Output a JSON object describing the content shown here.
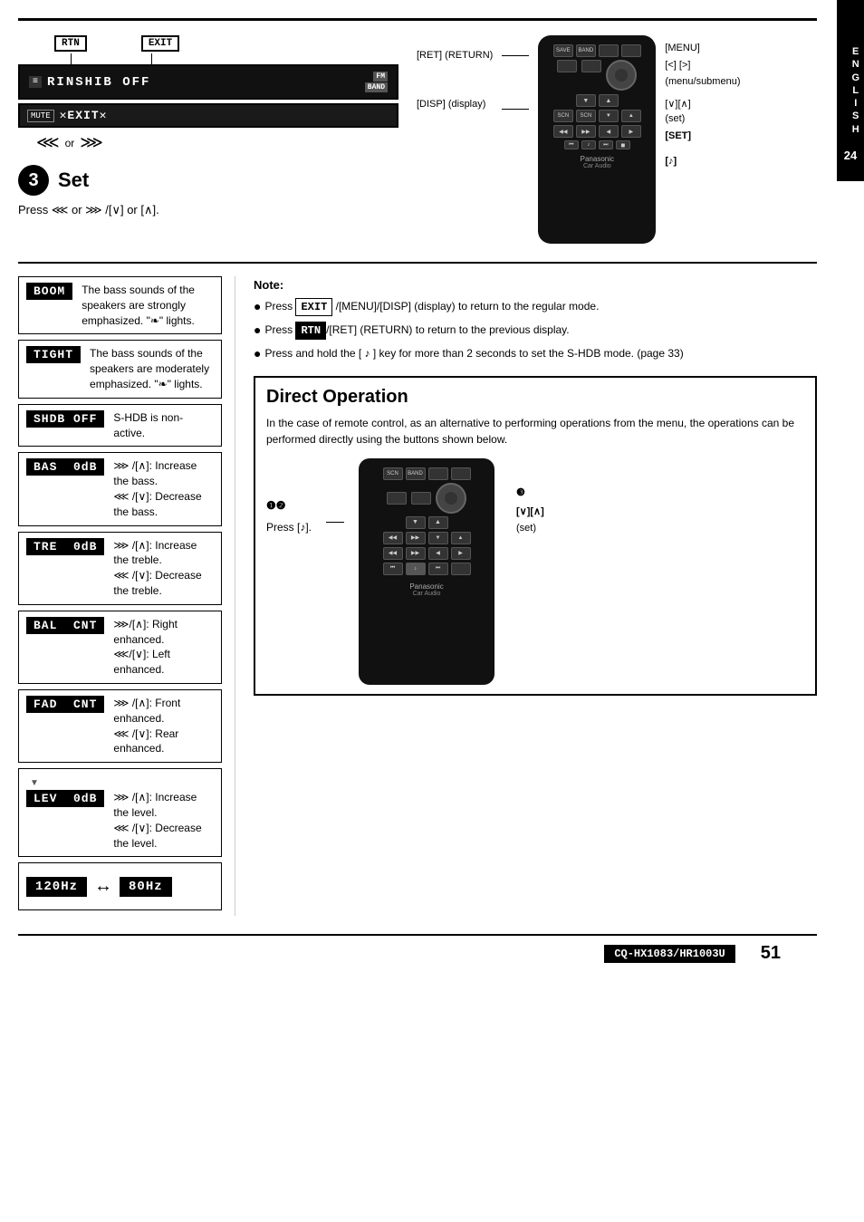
{
  "page": {
    "number": "51",
    "model": "CQ-HX1083/HR1003U",
    "lang_tab": [
      "E",
      "N",
      "G",
      "L",
      "I",
      "S",
      "H"
    ],
    "lang_num": "24"
  },
  "top_section": {
    "display_text": "RINSHIB OFF",
    "btn_rtn": "RTN",
    "btn_exit": "EXIT",
    "or_text": "or",
    "step3_circle": "3",
    "step3_title": "Set",
    "press_text": "Press",
    "press_instruction": "Press  ◀◀  or  ▶▶ /[∨] or [∧]."
  },
  "remote_labels": {
    "ret_return": "[RET] (RETURN)",
    "menu": "[MENU]",
    "ltgt": "[<] [>]",
    "menu_submenu": "(menu/submenu)",
    "vcaret": "[∨][∧]",
    "set": "(set)",
    "set_bracket": "[SET]",
    "disp": "[DISP] (display)",
    "music_note": "[♪]"
  },
  "settings": [
    {
      "label": "BOOM",
      "desc": "The bass sounds of the speakers are strongly emphasized. \"❧\" lights."
    },
    {
      "label": "TIGHT",
      "desc": "The bass sounds of the speakers are moderately emphasized. \"❧\" lights."
    },
    {
      "label": "SHDB OFF",
      "desc": "S-HDB is non-active."
    },
    {
      "label": "BAS  0dB",
      "up_desc": "▶▶ /[∧]: Increase the bass.",
      "down_desc": "◀◀ /[∨]: Decrease the bass."
    },
    {
      "label": "TRE  0dB",
      "up_desc": "▶▶ /[∧]: Increase the treble.",
      "down_desc": "◀◀ /[∨]: Decrease the treble."
    },
    {
      "label": "BAL  CNT",
      "up_desc": "▶▶/[∧]: Right enhanced.",
      "down_desc": "◀◀/[∨]: Left enhanced."
    },
    {
      "label": "FAD  CNT",
      "up_desc": "▶▶ /[∧]: Front enhanced.",
      "down_desc": "◀◀ /[∨]: Rear enhanced."
    },
    {
      "label": "LEV  0dB",
      "up_desc": "▶▶ /[∧]: Increase the level.",
      "down_desc": "◀◀ /[∨]: Decrease the level."
    }
  ],
  "freq_row": {
    "left": "120Hz",
    "arrow": "↔",
    "right": "80Hz"
  },
  "notes": {
    "title": "Note:",
    "items": [
      "Press  EXIT  /[MENU]/[DISP] (display) to return to the regular mode.",
      "Press  RTN /[RET] (RETURN) to return to the previous display.",
      "Press and hold the [ ♪ ] key for more than 2 seconds to set the S-HDB mode. (page 33)"
    ]
  },
  "direct_op": {
    "title": "Direct Operation",
    "desc": "In the case of remote control, as an alternative to performing operations from the menu, the operations can be performed directly using the buttons shown below.",
    "annotations": {
      "circled_3": "❸",
      "vcaret": "[∨][∧]",
      "set": "(set)",
      "circled_12": "❶❷",
      "press_note": "Press [♪]."
    }
  }
}
